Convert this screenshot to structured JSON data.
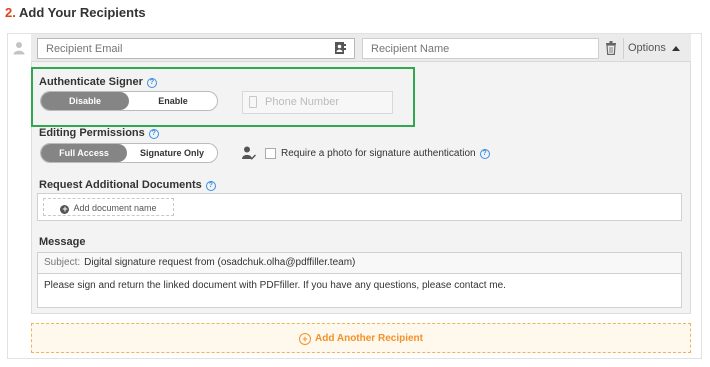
{
  "section": {
    "number": "2.",
    "title": "Add Your Recipients"
  },
  "recipient": {
    "email_placeholder": "Recipient Email",
    "name_placeholder": "Recipient Name",
    "options_label": "Options"
  },
  "authenticate": {
    "label": "Authenticate Signer",
    "disable_label": "Disable",
    "enable_label": "Enable",
    "selected": "Disable",
    "phone_placeholder": "Phone Number"
  },
  "permissions": {
    "label": "Editing Permissions",
    "full_access_label": "Full Access",
    "signature_only_label": "Signature Only",
    "selected": "Full Access",
    "photo_label": "Require a photo for signature authentication",
    "photo_checked": false
  },
  "documents": {
    "label": "Request Additional Documents",
    "add_label": "Add document name"
  },
  "message": {
    "label": "Message",
    "subject_label": "Subject:",
    "subject_value": "Digital signature request from  (osadchuk.olha@pdffiller.team)",
    "body": "Please sign and return the linked document with PDFfiller. If you have any questions, please contact me."
  },
  "add_recipient_label": "Add Another Recipient",
  "colors": {
    "accent_orange": "#f2922b",
    "highlight_green": "#2fa84f",
    "title_number": "#e0421b"
  }
}
